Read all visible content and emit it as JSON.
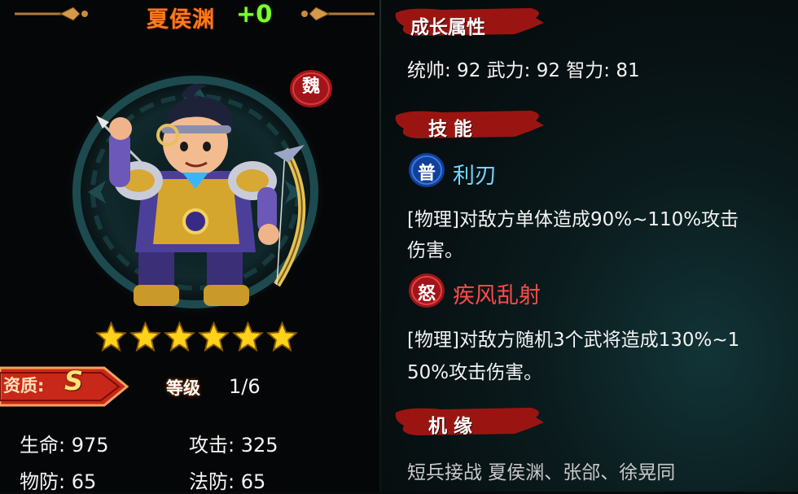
{
  "hero": {
    "name": "夏侯渊",
    "plus": "+0",
    "faction": "魏",
    "stars": 6
  },
  "quality": {
    "label": "资质:",
    "value": "S"
  },
  "level": {
    "label": "等级",
    "value": "1/6"
  },
  "stats": {
    "hp": "生命: 975",
    "attack": "攻击: 325",
    "phys_def": "物防: 65",
    "magic_def": "法防: 65"
  },
  "growth": {
    "title": "成长属性",
    "values": "统帅: 92   武力: 92   智力: 81"
  },
  "skills": {
    "title": "技  能",
    "items": [
      {
        "badge": "普",
        "name": "利刃",
        "desc_line1": "[物理]对敌方单体造成90%~110%攻击",
        "desc_line2": "伤害。"
      },
      {
        "badge": "怒",
        "name": "疾风乱射",
        "desc_line1": "[物理]对敌方随机3个武将造成130%~1",
        "desc_line2": "50%攻击伤害。"
      }
    ]
  },
  "bond": {
    "title": "机  缘",
    "text": "短兵接战  夏侯渊、张郃、徐晃同"
  },
  "colors": {
    "name_orange": "#ff7a1a",
    "plus_green": "#7dff2f",
    "skill_blue": "#6fd6ff",
    "skill_red": "#ff4a4a",
    "banner_red": "#9a1512"
  }
}
